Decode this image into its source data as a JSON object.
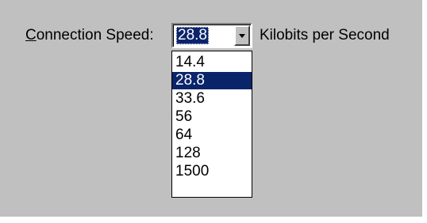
{
  "connection": {
    "label": "Connection Speed:",
    "label_accelerator": "C",
    "label_rest": "onnection Speed:",
    "selected_value": "28.8",
    "unit_label": "Kilobits per Second"
  },
  "dropdown": {
    "options": [
      {
        "label": "14.4",
        "selected": false
      },
      {
        "label": "28.8",
        "selected": true
      },
      {
        "label": "33.6",
        "selected": false
      },
      {
        "label": "56",
        "selected": false
      },
      {
        "label": "64",
        "selected": false
      },
      {
        "label": "128",
        "selected": false
      },
      {
        "label": "1500",
        "selected": false
      }
    ]
  },
  "colors": {
    "dialog_face": "#c0c0c0",
    "selection_highlight": "#0a246a",
    "selection_text": "#ffffff"
  },
  "icons": {
    "dropdown_button": "chevron-down-icon"
  }
}
